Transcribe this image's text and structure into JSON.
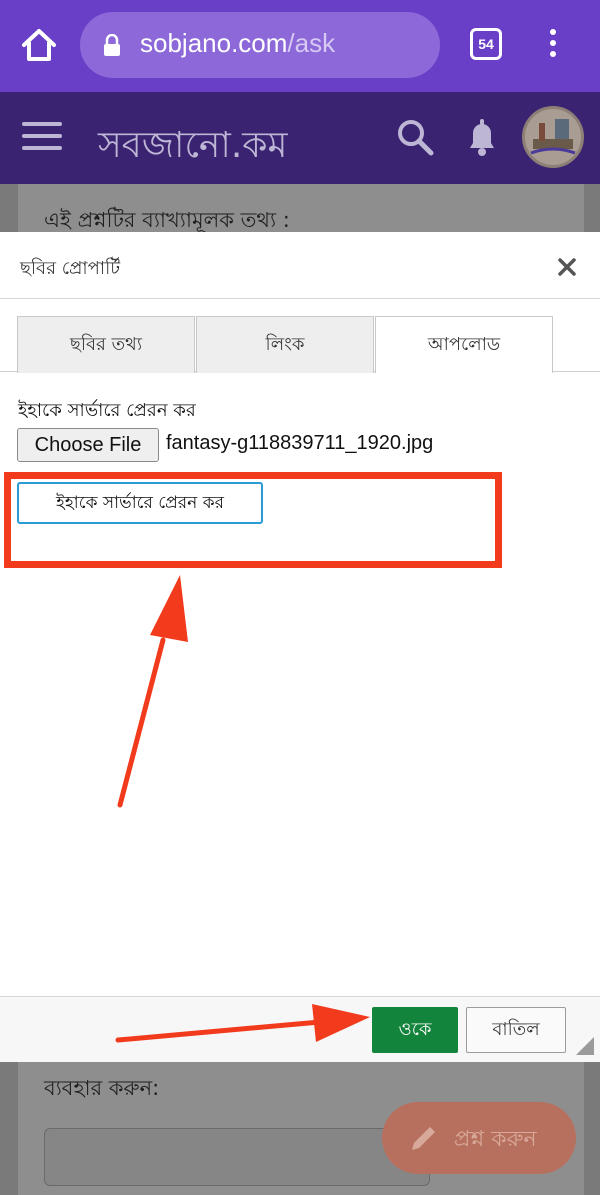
{
  "browser": {
    "url_domain": "sobjano.com",
    "url_path": "/ask",
    "tab_count": "54"
  },
  "site": {
    "title": "সবজানো.কম"
  },
  "page": {
    "explain_label": "এই প্রশ্নটির ব্যাখ্যামূলক তথ্য :",
    "use_label": "ব্যবহার করুন:",
    "fab_label": "প্রশ্ন করুন"
  },
  "dialog": {
    "title": "ছবির প্রোপার্টি",
    "tabs": [
      {
        "label": "ছবির তথ্য",
        "active": false
      },
      {
        "label": "লিংক",
        "active": false
      },
      {
        "label": "আপলোড",
        "active": true
      }
    ],
    "upload_label": "ইহাকে সার্ভারে প্রেরন কর",
    "choose_file_label": "Choose File",
    "file_name": "fantasy-g118839711_1920.jpg",
    "send_button_label": "ইহাকে সার্ভারে প্রেরন কর",
    "ok_label": "ওকে",
    "cancel_label": "বাতিল"
  },
  "colors": {
    "browser_bar": "#6a3fc8",
    "site_header": "#3a2371",
    "ok_button": "#13843b",
    "annotation": "#f23a1c",
    "send_button_border": "#2b9bd6"
  }
}
